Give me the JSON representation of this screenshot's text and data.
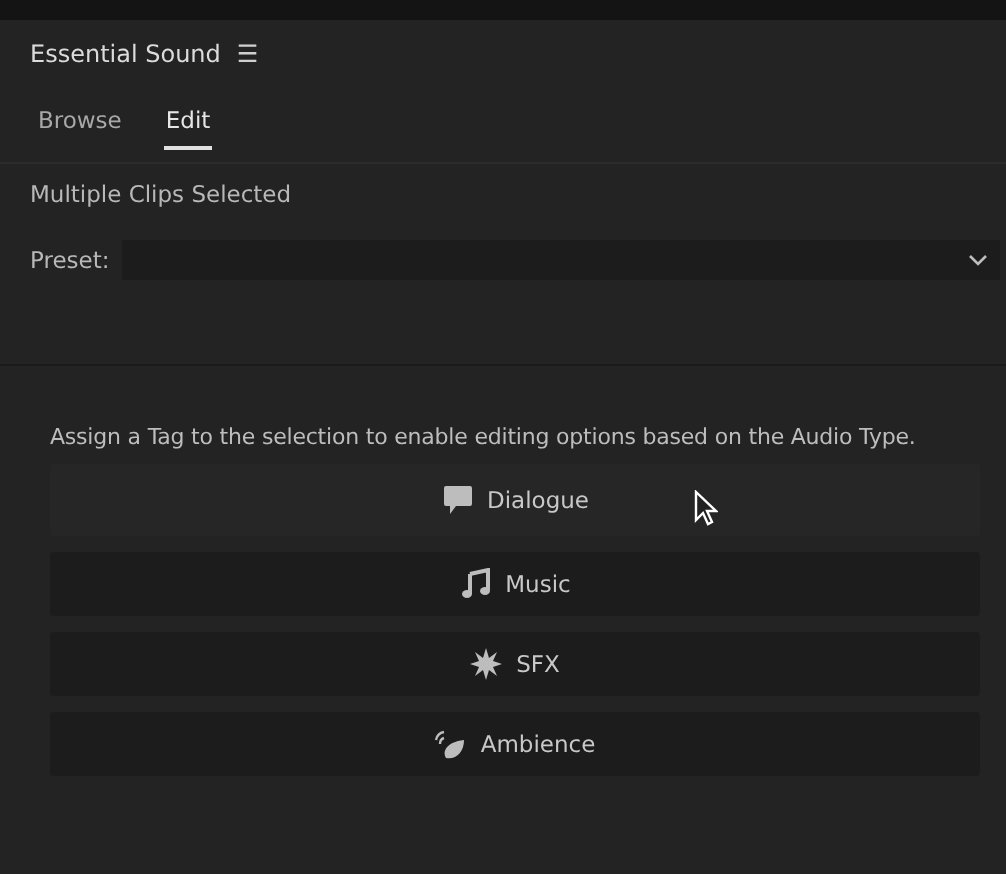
{
  "panel": {
    "title": "Essential Sound",
    "menu_icon": "☰"
  },
  "tabs": [
    {
      "label": "Browse",
      "selected": false
    },
    {
      "label": "Edit",
      "selected": true
    }
  ],
  "selection_label": "Multiple Clips Selected",
  "preset": {
    "label": "Preset:"
  },
  "instruction": "Assign a Tag to the selection to enable editing options based on the Audio Type.",
  "audio_types": [
    {
      "kind": "dialogue",
      "label": "Dialogue",
      "hovered": true
    },
    {
      "kind": "music",
      "label": "Music",
      "hovered": false
    },
    {
      "kind": "sfx",
      "label": "SFX",
      "hovered": false
    },
    {
      "kind": "ambience",
      "label": "Ambience",
      "hovered": false
    }
  ]
}
